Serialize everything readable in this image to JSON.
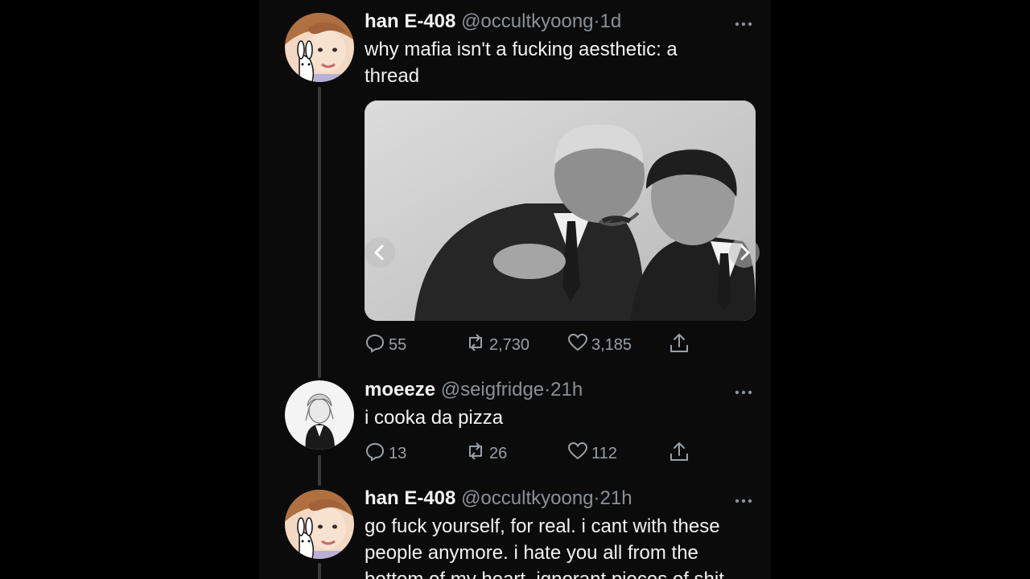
{
  "tweets": [
    {
      "name": "han E-408",
      "handle": "@occultkyoong",
      "separator": "·",
      "time": "1d",
      "text": "why mafia isn't a fucking aesthetic: a thread",
      "replies": "55",
      "retweets": "2,730",
      "likes": "3,185",
      "has_media": true
    },
    {
      "name": "moeeze",
      "handle": "@seigfridge",
      "separator": "·",
      "time": "21h",
      "text": "i cooka da pizza",
      "replies": "13",
      "retweets": "26",
      "likes": "112"
    },
    {
      "name": "han E-408",
      "handle": "@occultkyoong",
      "separator": "·",
      "time": "21h",
      "text": "go fuck yourself, for real. i cant with these people anymore. i hate you all from the bottom of my heart. ignorant pieces of shit"
    }
  ],
  "icons": {
    "reply": "reply-icon",
    "retweet": "retweet-icon",
    "like": "heart-icon",
    "share": "share-icon",
    "more": "more-icon"
  },
  "colors": {
    "background": "#000000",
    "panel": "#0b0b0b",
    "text": "#f2f2f2",
    "muted": "#8b9097"
  }
}
